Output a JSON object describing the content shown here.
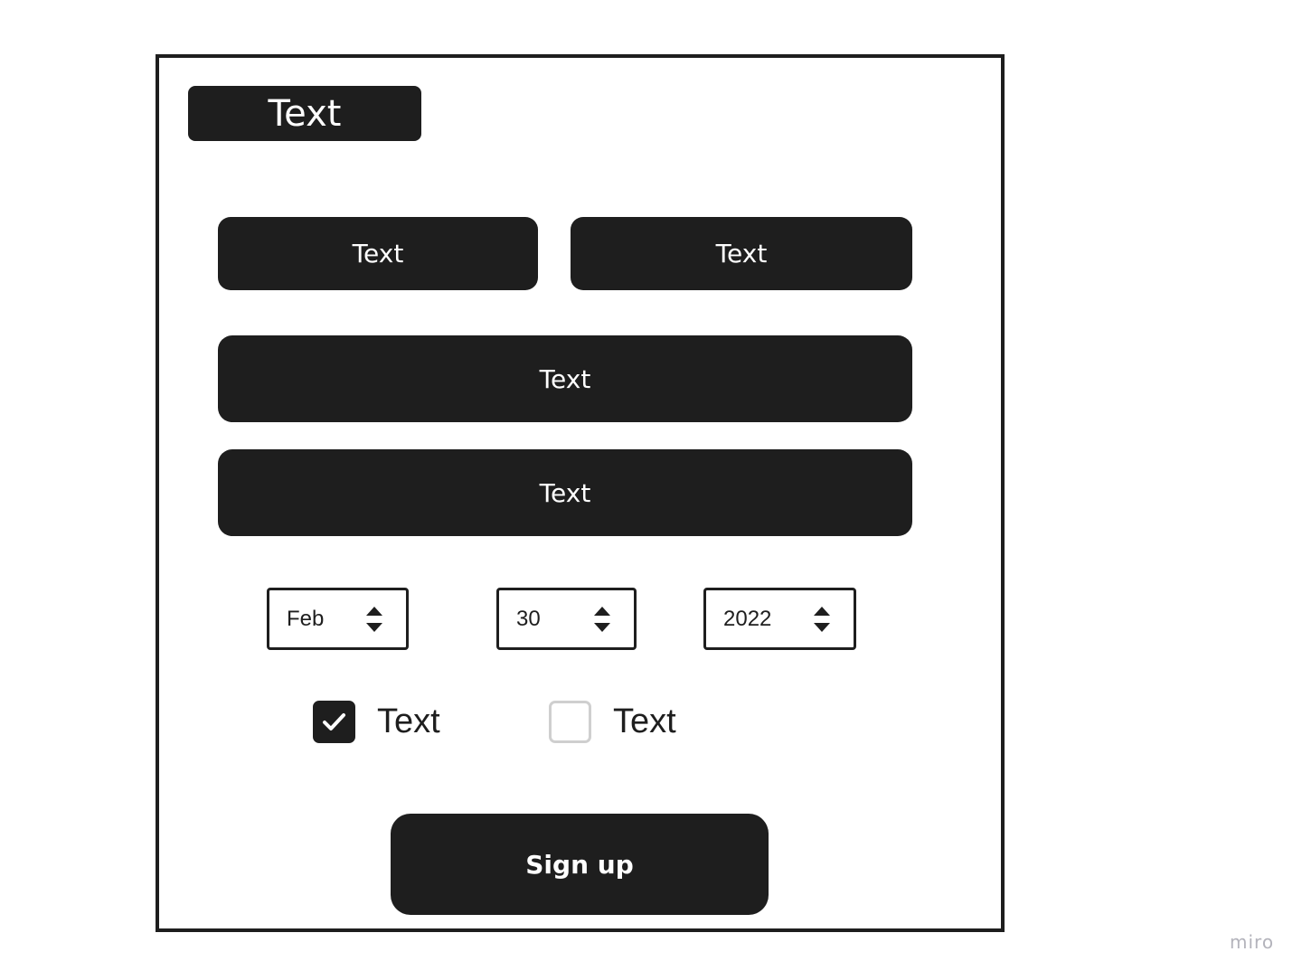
{
  "form": {
    "title": "Text",
    "button_row": {
      "left_label": "Text",
      "right_label": "Text"
    },
    "full_button_1_label": "Text",
    "full_button_2_label": "Text",
    "date": {
      "month": "Feb",
      "day": "30",
      "year": "2022"
    },
    "checkboxes": [
      {
        "label": "Text",
        "checked": true
      },
      {
        "label": "Text",
        "checked": false
      }
    ],
    "submit_label": "Sign up"
  },
  "watermark": "miro",
  "colors": {
    "dark": "#1e1e1e",
    "background": "#ffffff",
    "checkbox_unchecked_border": "#cfcfcf"
  },
  "icons": {
    "stepper": "up-down-chevron-icon",
    "checkmark": "checkmark-icon"
  }
}
